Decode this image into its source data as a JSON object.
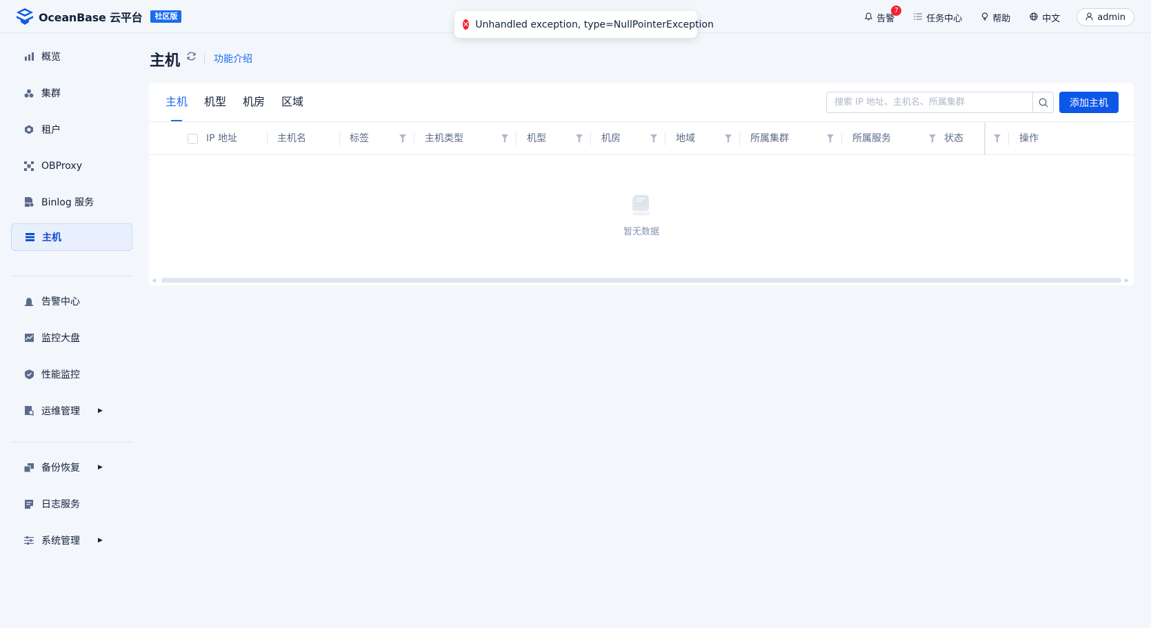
{
  "brand": {
    "name": "OceanBase 云平台",
    "edition": "社区版"
  },
  "toast": {
    "message": "Unhandled exception, type=NullPointerException"
  },
  "topnav": {
    "alerts": "告警",
    "alerts_count": "7",
    "tasks": "任务中心",
    "help": "帮助",
    "language": "中文",
    "user": "admin"
  },
  "sidebar": {
    "items": [
      {
        "label": "概览",
        "icon": "bar-chart-icon"
      },
      {
        "label": "集群",
        "icon": "cluster-icon"
      },
      {
        "label": "租户",
        "icon": "tenant-icon"
      },
      {
        "label": "OBProxy",
        "icon": "proxy-icon"
      },
      {
        "label": "Binlog 服务",
        "icon": "binlog-icon"
      },
      {
        "label": "主机",
        "icon": "host-icon",
        "active": true
      },
      {
        "label": "告警中心",
        "icon": "alarm-icon"
      },
      {
        "label": "监控大盘",
        "icon": "monitor-icon"
      },
      {
        "label": "性能监控",
        "icon": "performance-icon"
      },
      {
        "label": "运维管理",
        "icon": "ops-icon",
        "expandable": true
      },
      {
        "label": "备份恢复",
        "icon": "backup-icon",
        "expandable": true
      },
      {
        "label": "日志服务",
        "icon": "log-icon"
      },
      {
        "label": "系统管理",
        "icon": "settings-icon",
        "expandable": true
      }
    ]
  },
  "page": {
    "title": "主机",
    "intro_link": "功能介绍"
  },
  "tabs": [
    "主机",
    "机型",
    "机房",
    "区域"
  ],
  "search": {
    "placeholder": "搜索 IP 地址、主机名、所属集群"
  },
  "add_button": "添加主机",
  "table": {
    "columns": [
      "IP 地址",
      "主机名",
      "标签",
      "主机类型",
      "机型",
      "机房",
      "地域",
      "所属集群",
      "所属服务",
      "状态",
      "操作"
    ],
    "empty_text": "暂无数据"
  },
  "colors": {
    "primary": "#0d57e8",
    "link": "#1a6cf0",
    "error": "#f5222d",
    "background": "#f3f6fb"
  }
}
